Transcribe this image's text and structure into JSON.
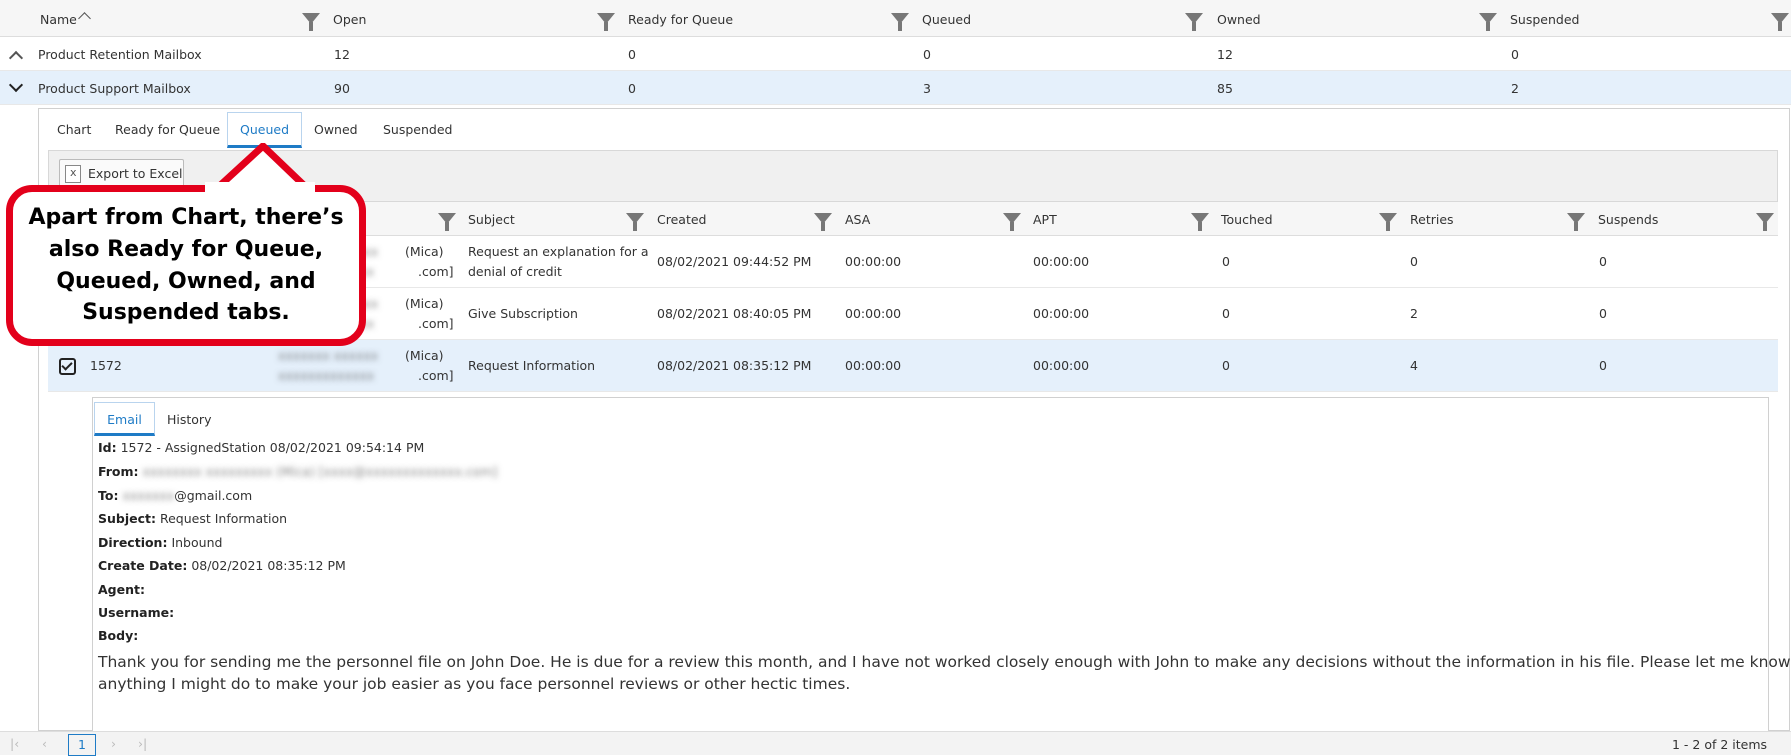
{
  "grid": {
    "columns": [
      "Name",
      "Open",
      "Ready for Queue",
      "Queued",
      "Owned",
      "Suspended"
    ],
    "rows": [
      {
        "name": "Product Retention Mailbox",
        "open": "12",
        "ready": "0",
        "queued": "0",
        "owned": "12",
        "suspended": "0"
      },
      {
        "name": "Product Support Mailbox",
        "open": "90",
        "ready": "0",
        "queued": "3",
        "owned": "85",
        "suspended": "2"
      }
    ]
  },
  "detail_tabs": [
    "Chart",
    "Ready for Queue",
    "Queued",
    "Owned",
    "Suspended"
  ],
  "active_tab": "Queued",
  "toolbar": {
    "export_label": "Export to Excel"
  },
  "queued_grid": {
    "columns": [
      "Subject",
      "Created",
      "ASA",
      "APT",
      "Touched",
      "Retries",
      "Suspends"
    ],
    "rows": [
      {
        "id": "",
        "from_suffix_1": "(Mica)",
        "from_suffix_2": ".com]",
        "subject_1": "Request an explanation for a",
        "subject_2": "denial of credit",
        "created": "08/02/2021 09:44:52 PM",
        "asa": "00:00:00",
        "apt": "00:00:00",
        "touched": "0",
        "retries": "0",
        "suspends": "0"
      },
      {
        "id": "",
        "from_suffix_1": "(Mica)",
        "from_suffix_2": ".com]",
        "subject_1": "Give Subscription",
        "subject_2": "",
        "created": "08/02/2021 08:40:05 PM",
        "asa": "00:00:00",
        "apt": "00:00:00",
        "touched": "0",
        "retries": "2",
        "suspends": "0"
      },
      {
        "id": "1572",
        "from_suffix_1": "(Mica)",
        "from_suffix_2": ".com]",
        "subject_1": "Request Information",
        "subject_2": "",
        "created": "08/02/2021 08:35:12 PM",
        "asa": "00:00:00",
        "apt": "00:00:00",
        "touched": "0",
        "retries": "4",
        "suspends": "0"
      }
    ]
  },
  "email_tabs": [
    "Email",
    "History"
  ],
  "email": {
    "id_label": "Id:",
    "id_value": "1572 - AssignedStation 08/02/2021 09:54:14 PM",
    "from_label": "From:",
    "to_label": "To:",
    "to_value": "@gmail.com",
    "subject_label": "Subject:",
    "subject_value": "Request Information",
    "direction_label": "Direction:",
    "direction_value": "Inbound",
    "create_date_label": "Create Date:",
    "create_date_value": "08/02/2021 08:35:12 PM",
    "agent_label": "Agent:",
    "username_label": "Username:",
    "body_label": "Body:",
    "body_line_1": "Thank you for sending me the personnel file on John Doe. He is due for a review this month, and I have not worked closely enough with John to make any decisions without the information in his file. Please let me know if there is",
    "body_line_2": "anything I might do to make your job easier as you face personnel reviews or other hectic times."
  },
  "pager": {
    "page": "1",
    "summary": "1 - 2 of 2 items"
  },
  "callout": {
    "text": "Apart from Chart, there’s also Ready for Queue, Queued, Owned, and Suspended tabs."
  },
  "colors": {
    "accent": "#1e7bc6",
    "selected_row": "#e5f0fb",
    "callout_border": "#e3001b"
  }
}
